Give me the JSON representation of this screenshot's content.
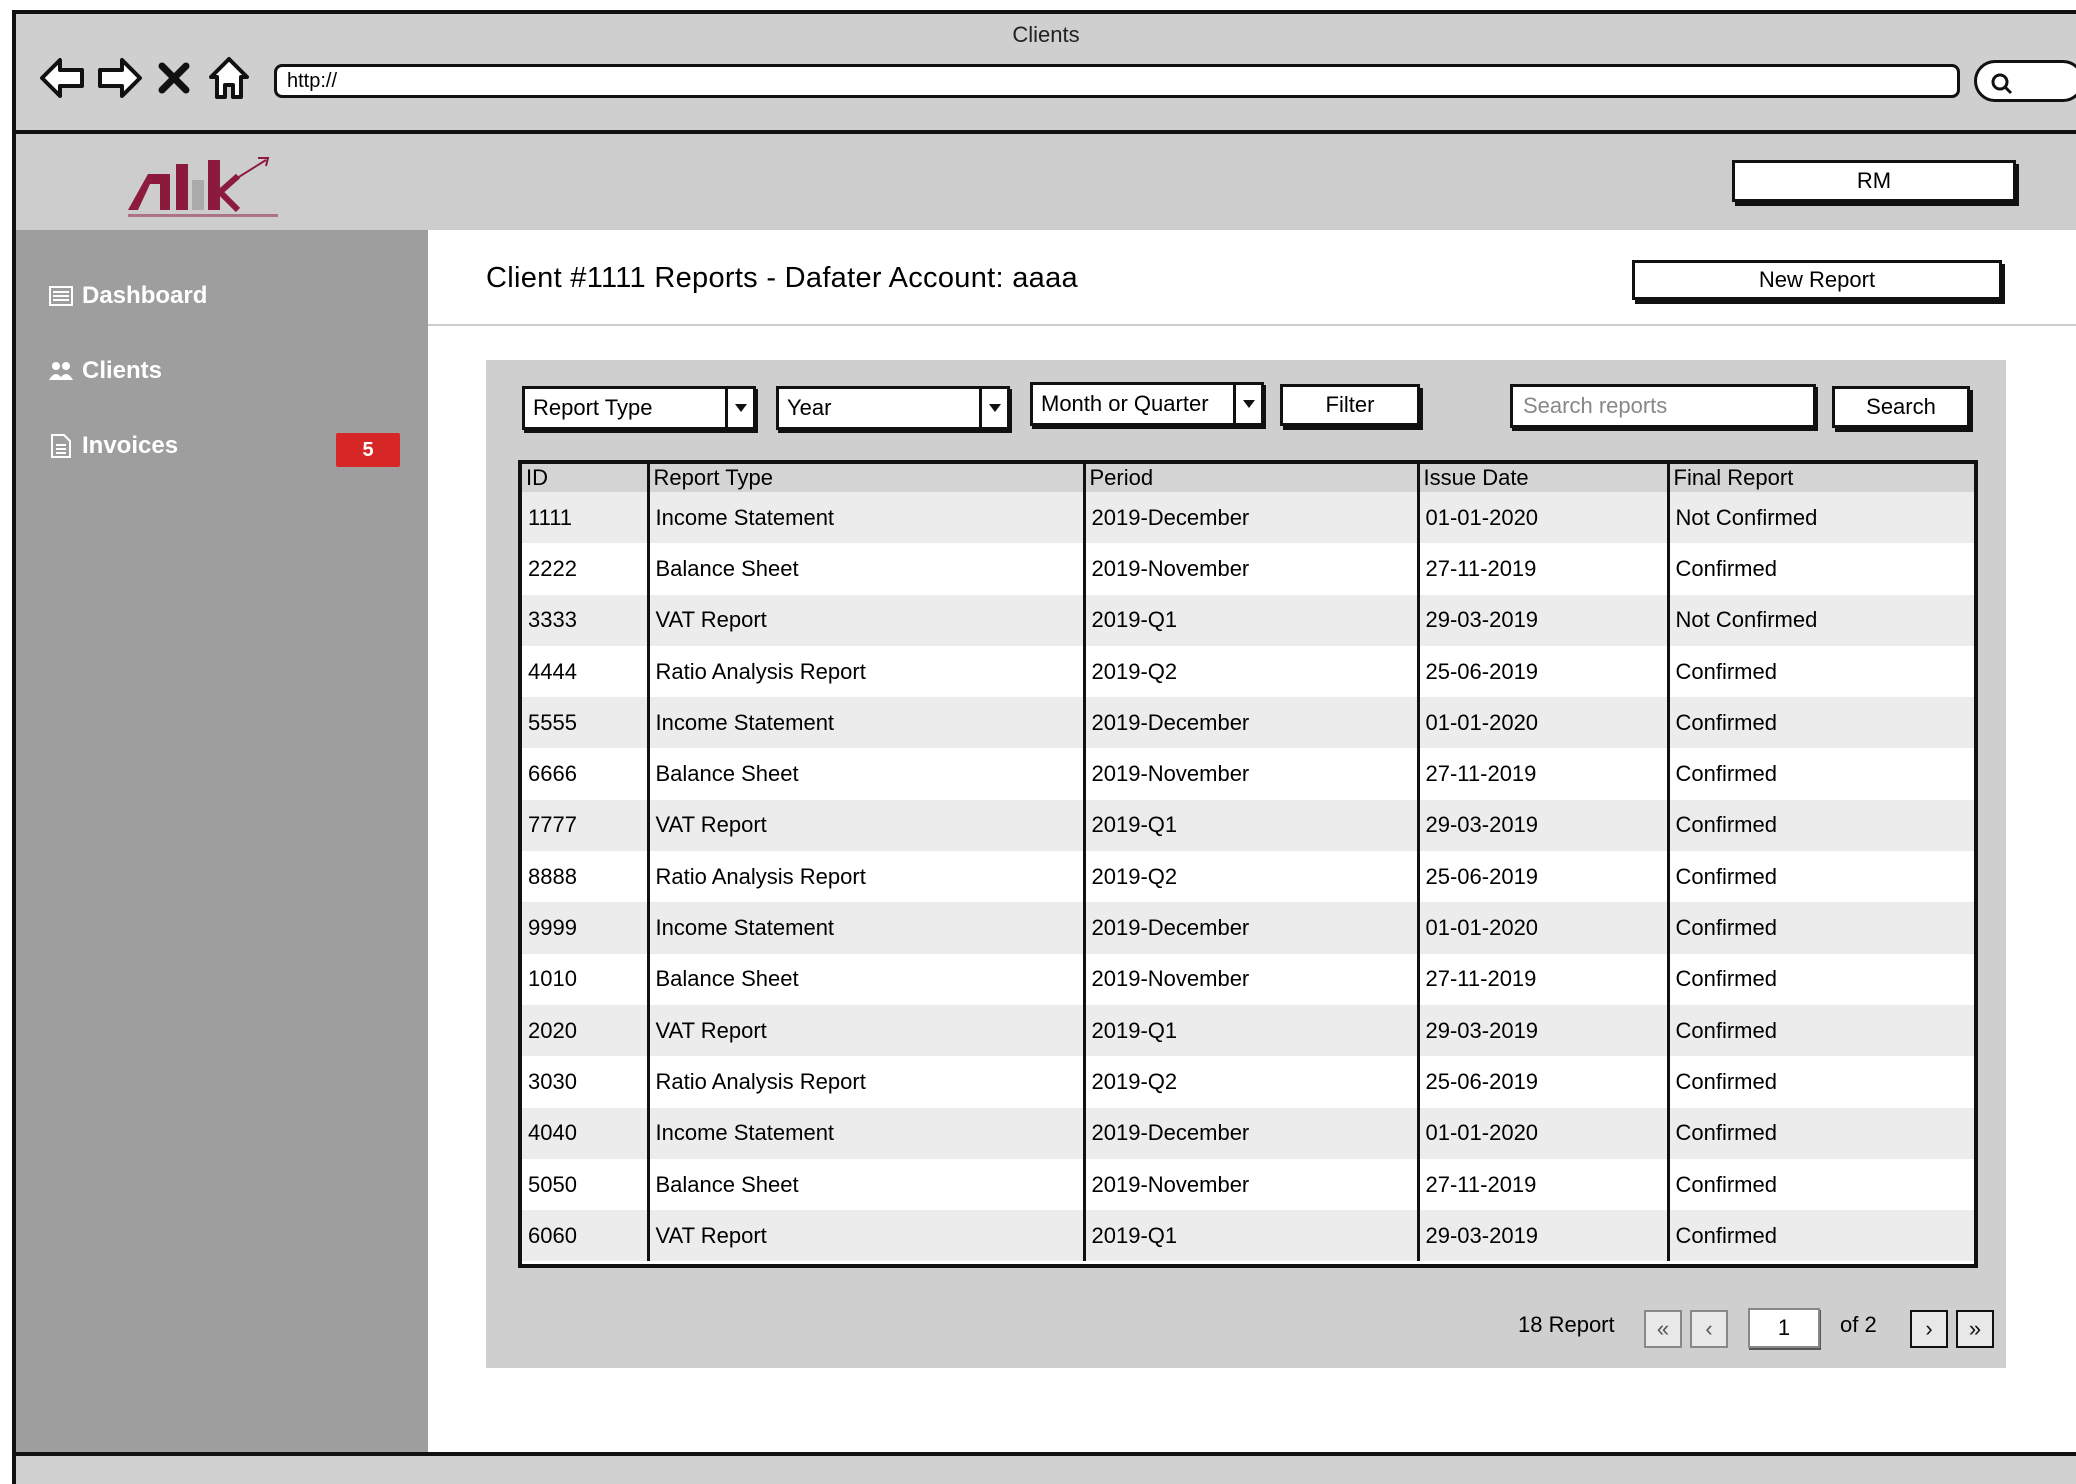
{
  "browser": {
    "title": "Clients",
    "url": "http://"
  },
  "header": {
    "user_label": "RM"
  },
  "sidebar": {
    "items": [
      {
        "label": "Dashboard",
        "icon": "dashboard-icon"
      },
      {
        "label": "Clients",
        "icon": "users-icon"
      },
      {
        "label": "Invoices",
        "icon": "document-icon",
        "badge": "5"
      }
    ]
  },
  "main": {
    "title": "Client #1111 Reports - Dafater Account: aaaa",
    "new_report_label": "New Report"
  },
  "filters": {
    "report_type": "Report Type",
    "year": "Year",
    "period": "Month or Quarter",
    "filter_label": "Filter",
    "search_placeholder": "Search reports",
    "search_label": "Search"
  },
  "table": {
    "columns": [
      "ID",
      "Report Type",
      "Period",
      "Issue Date",
      "Final Report"
    ],
    "rows": [
      [
        "1111",
        "Income Statement",
        "2019-December",
        "01-01-2020",
        "Not Confirmed"
      ],
      [
        "2222",
        "Balance Sheet",
        "2019-November",
        "27-11-2019",
        "Confirmed"
      ],
      [
        "3333",
        "VAT Report",
        "2019-Q1",
        "29-03-2019",
        "Not Confirmed"
      ],
      [
        "4444",
        "Ratio Analysis Report",
        "2019-Q2",
        "25-06-2019",
        "Confirmed"
      ],
      [
        "5555",
        "Income Statement",
        "2019-December",
        "01-01-2020",
        "Confirmed"
      ],
      [
        "6666",
        "Balance Sheet",
        "2019-November",
        "27-11-2019",
        "Confirmed"
      ],
      [
        "7777",
        "VAT Report",
        "2019-Q1",
        "29-03-2019",
        "Confirmed"
      ],
      [
        "8888",
        "Ratio Analysis Report",
        "2019-Q2",
        "25-06-2019",
        "Confirmed"
      ],
      [
        "9999",
        "Income Statement",
        "2019-December",
        "01-01-2020",
        "Confirmed"
      ],
      [
        "1010",
        "Balance Sheet",
        "2019-November",
        "27-11-2019",
        "Confirmed"
      ],
      [
        "2020",
        "VAT Report",
        "2019-Q1",
        "29-03-2019",
        "Confirmed"
      ],
      [
        "3030",
        "Ratio Analysis Report",
        "2019-Q2",
        "25-06-2019",
        "Confirmed"
      ],
      [
        "4040",
        "Income Statement",
        "2019-December",
        "01-01-2020",
        "Confirmed"
      ],
      [
        "5050",
        "Balance Sheet",
        "2019-November",
        "27-11-2019",
        "Confirmed"
      ],
      [
        "6060",
        "VAT Report",
        "2019-Q1",
        "29-03-2019",
        "Confirmed"
      ]
    ]
  },
  "pagination": {
    "count_label": "18 Report",
    "current_page": "1",
    "of_label": "of 2",
    "first": "«",
    "prev": "‹",
    "next": "›",
    "last": "»"
  },
  "colors": {
    "badge": "#d72626",
    "sidebar": "#9e9e9e",
    "logo": "#8b1a3c"
  }
}
